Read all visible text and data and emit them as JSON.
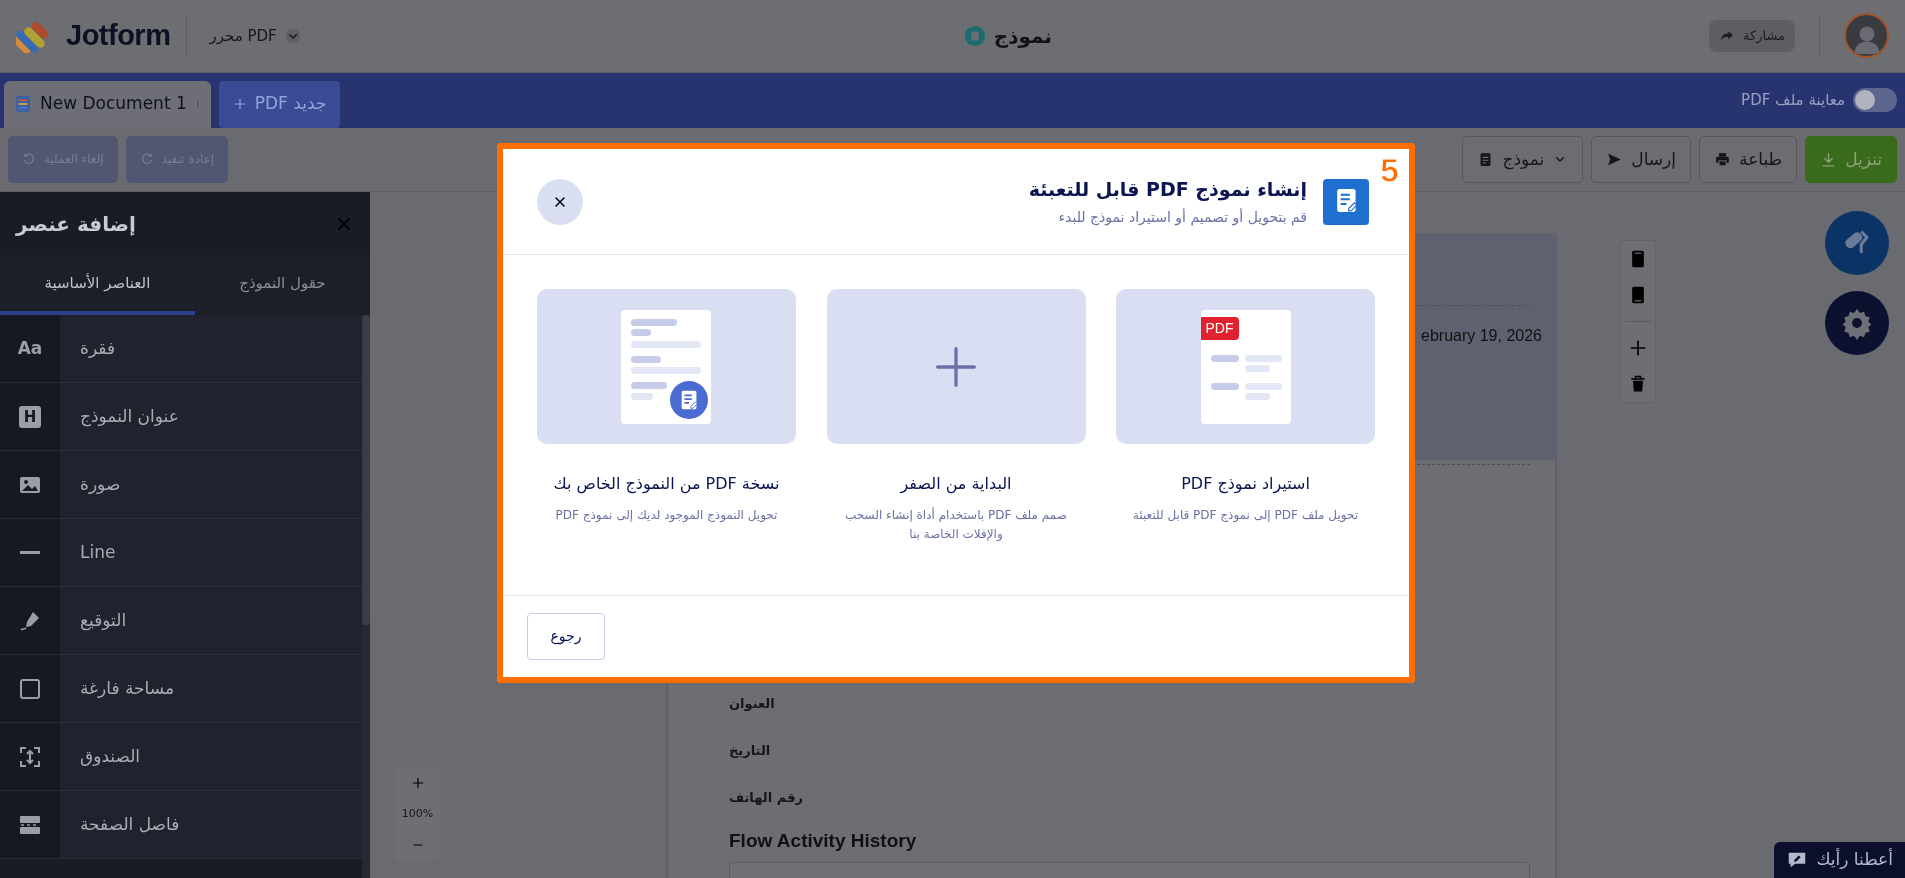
{
  "app": {
    "logo": "Jotform",
    "product": "محرر PDF",
    "form_title": "نموذج",
    "share": "مشاركة"
  },
  "tab_bar": {
    "documents": [
      {
        "label": "New Document 1",
        "selected": true
      }
    ],
    "new_button": "جديد PDF",
    "preview_toggle": {
      "label": "معاينة ملف PDF",
      "on": false
    }
  },
  "toolbar": {
    "history": [
      {
        "label": "إعادة تنفيذ",
        "kind": "redo",
        "disabled": true
      },
      {
        "label": "إلغاء العملية",
        "kind": "undo",
        "disabled": true
      }
    ],
    "actions": [
      {
        "label": "تنزيل",
        "kind": "download"
      },
      {
        "label": "طباعة",
        "kind": "print"
      },
      {
        "label": "إرسال",
        "kind": "send"
      },
      {
        "label": "نموذج",
        "kind": "dropdown"
      }
    ]
  },
  "element_panel": {
    "title": "إضافة عنصر",
    "tabs": [
      {
        "label": "حقول النموذج",
        "selected": false
      },
      {
        "label": "العناصر الأساسية",
        "selected": true
      }
    ],
    "items": [
      {
        "label": "فقرة",
        "kind": "text",
        "glyph": "Aa"
      },
      {
        "label": "عنوان النموذج",
        "kind": "heading",
        "glyph": "H"
      },
      {
        "label": "صورة",
        "kind": "image"
      },
      {
        "label": "Line",
        "kind": "line"
      },
      {
        "label": "التوقيع",
        "kind": "signature"
      },
      {
        "label": "مساحة فارغة",
        "kind": "spacer"
      },
      {
        "label": "الصندوق",
        "kind": "container"
      },
      {
        "label": "فاصل الصفحة",
        "kind": "pagebreak"
      }
    ]
  },
  "document": {
    "date": "ebruary 19, 2026",
    "labels": [
      "العنوان",
      "التاريخ",
      "رقم الهاتف"
    ],
    "section_heading": "Flow Activity History"
  },
  "zoom": {
    "reading": "100%"
  },
  "modal": {
    "step": "5",
    "title": "إنشاء نموذج PDF قابل للتعبئة",
    "subtitle": "قم بتحويل أو تصميم أو استيراد نموذج للبدء",
    "options": [
      {
        "kind": "import",
        "badge": "PDF",
        "title": "استيراد نموذج PDF",
        "description": "تحويل ملف PDF إلى نموذج PDF قابل للتعبئة"
      },
      {
        "kind": "scratch",
        "title": "البداية من الصفر",
        "description": "صمم ملف PDF باستخدام أداة إنشاء السحب والإفلات الخاصة بنا"
      },
      {
        "kind": "copy",
        "title": "نسخة PDF من النموذج الخاص بك",
        "description": "تحويل النموذج الموجود لديك إلى نموذج PDF"
      }
    ],
    "back_button": "رجوع"
  },
  "feedback": "أعطنا رأيك"
}
